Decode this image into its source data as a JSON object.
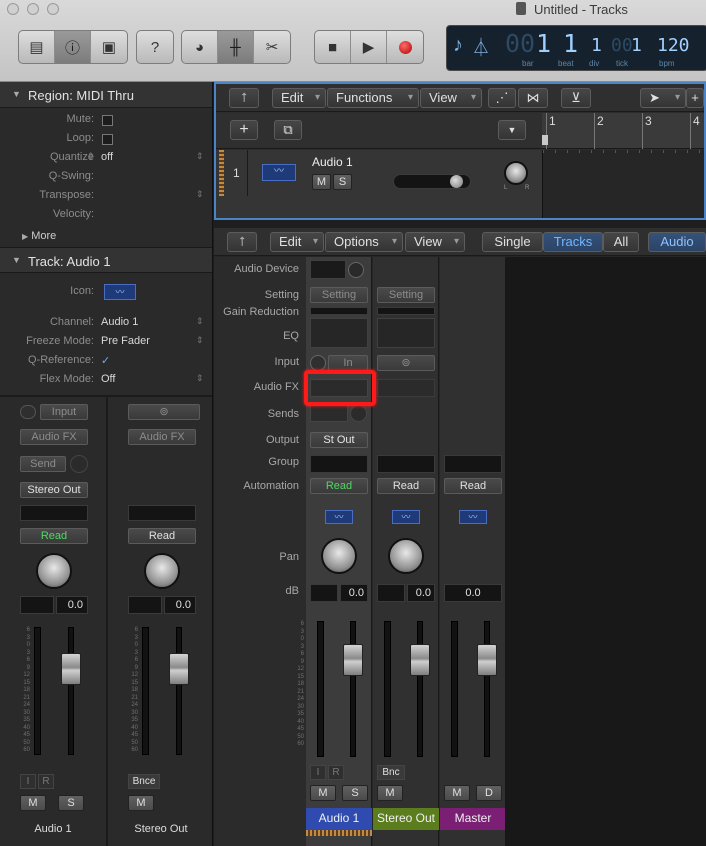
{
  "window": {
    "title": "Untitled - Tracks"
  },
  "lcd": {
    "bar": "1",
    "beat": "1",
    "div": "1",
    "tick": "1",
    "bpm": "120",
    "bar_ghost": "00",
    "tick_ghost": "00",
    "labels": {
      "bar": "bar",
      "beat": "beat",
      "div": "div",
      "tick": "tick",
      "bpm": "bpm"
    }
  },
  "region": {
    "header": "Region: MIDI Thru",
    "rows": [
      {
        "label": "Mute:",
        "value": ""
      },
      {
        "label": "Loop:",
        "value": ""
      },
      {
        "label": "Quantize",
        "value": "off"
      },
      {
        "label": "Q-Swing:",
        "value": ""
      },
      {
        "label": "Transpose:",
        "value": ""
      },
      {
        "label": "Velocity:",
        "value": ""
      }
    ],
    "more": "More"
  },
  "track": {
    "header": "Track:  Audio 1",
    "rows": [
      {
        "label": "Icon:",
        "value": ""
      },
      {
        "label": "Channel:",
        "value": "Audio 1"
      },
      {
        "label": "Freeze Mode:",
        "value": "Pre Fader"
      },
      {
        "label": "Q-Reference:",
        "value": "✓"
      },
      {
        "label": "Flex Mode:",
        "value": "Off"
      }
    ]
  },
  "inspector_strips": [
    {
      "input": "Input",
      "audiofx": "Audio FX",
      "send": "Send",
      "output": "Stereo Out",
      "automation": "Read",
      "db": "0.0",
      "r1": "I",
      "r2": "R",
      "m": "M",
      "s": "S",
      "name": "Audio 1"
    },
    {
      "input": "",
      "audiofx": "Audio FX",
      "send": "",
      "output": "",
      "automation": "Read",
      "db": "0.0",
      "r1": "Bnce",
      "r2": "",
      "m": "M",
      "s": "",
      "name": "Stereo Out"
    }
  ],
  "tracks_toolbar": {
    "edit": "Edit",
    "functions": "Functions",
    "view": "View"
  },
  "ruler": [
    "1",
    "2",
    "3",
    "4"
  ],
  "track_header": {
    "number": "1",
    "name": "Audio 1",
    "m": "M",
    "s": "S",
    "pan_l": "L",
    "pan_r": "R"
  },
  "mixer_toolbar": {
    "edit": "Edit",
    "options": "Options",
    "view": "View",
    "single": "Single",
    "tracks": "Tracks",
    "all": "All",
    "audio": "Audio"
  },
  "mixer_labels": [
    "Audio Device",
    "Setting",
    "Gain Reduction",
    "EQ",
    "Input",
    "Audio FX",
    "Sends",
    "Output",
    "Group",
    "Automation",
    "Pan",
    "dB"
  ],
  "mixer_channels": [
    {
      "name": "Audio 1",
      "setting": "Setting",
      "input": "In",
      "output": "St Out",
      "automation": "Read",
      "db": "0.0",
      "r1": "I",
      "r2": "R",
      "m": "M",
      "s": "S",
      "color": "#2f4bb0"
    },
    {
      "name": "Stereo Out",
      "setting": "Setting",
      "input": "",
      "output": "",
      "automation": "Read",
      "db": "0.0",
      "r1": "Bnc",
      "r2": "",
      "m": "M",
      "s": "",
      "color": "#5b7d1e"
    },
    {
      "name": "Master",
      "setting": "",
      "input": "",
      "output": "",
      "automation": "Read",
      "db": "0.0",
      "r1": "",
      "r2": "",
      "m": "M",
      "s": "D",
      "color": "#7a1f73"
    }
  ],
  "scale": [
    "6",
    "3",
    "0",
    "3",
    "6",
    "9",
    "12",
    "15",
    "18",
    "21",
    "24",
    "30",
    "35",
    "40",
    "45",
    "50",
    "60"
  ],
  "colors": {
    "accent": "#4b84c7",
    "highlight": "#ff1a1a",
    "read": "#4fd860"
  }
}
